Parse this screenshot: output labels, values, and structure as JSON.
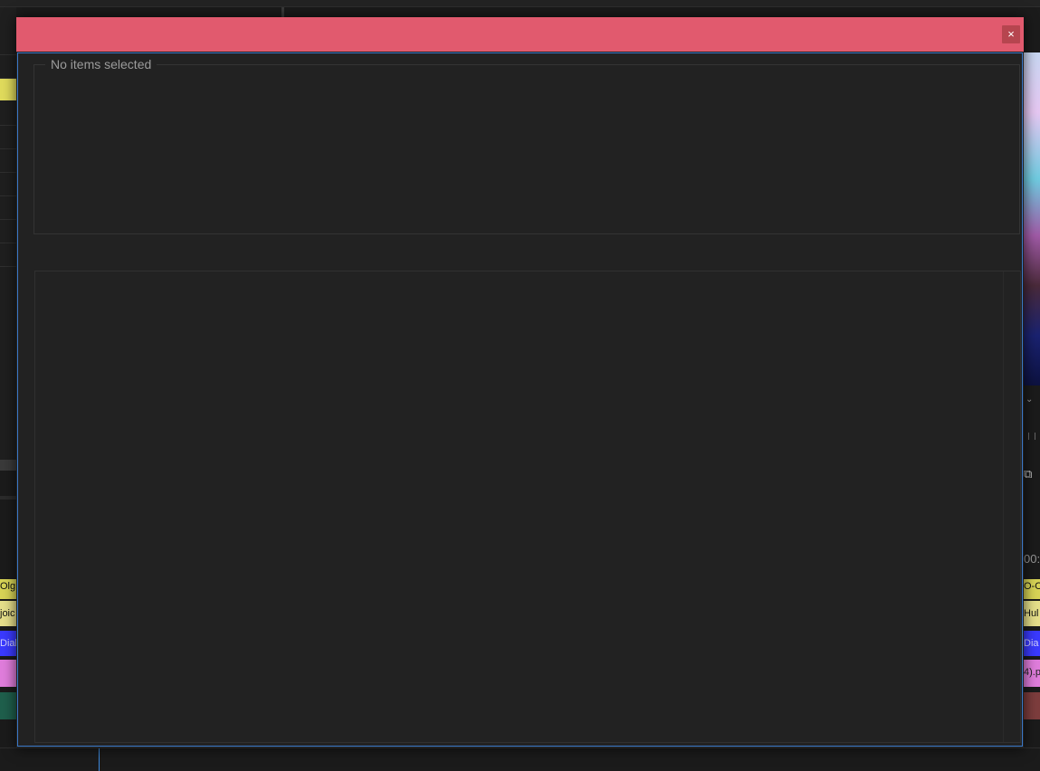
{
  "dialog": {
    "title": "",
    "close_label": "×",
    "group_legend": "No items selected",
    "accent_title_color": "#e15a6e",
    "focus_border_color": "#3a78c8"
  },
  "background": {
    "timecode": "00:",
    "clips_left": [
      "Olg",
      "joic",
      "Dialo",
      "",
      "",
      ""
    ],
    "clips_right": [
      "O-C",
      "Hul",
      "Dia",
      "4).pn",
      "",
      ""
    ]
  }
}
